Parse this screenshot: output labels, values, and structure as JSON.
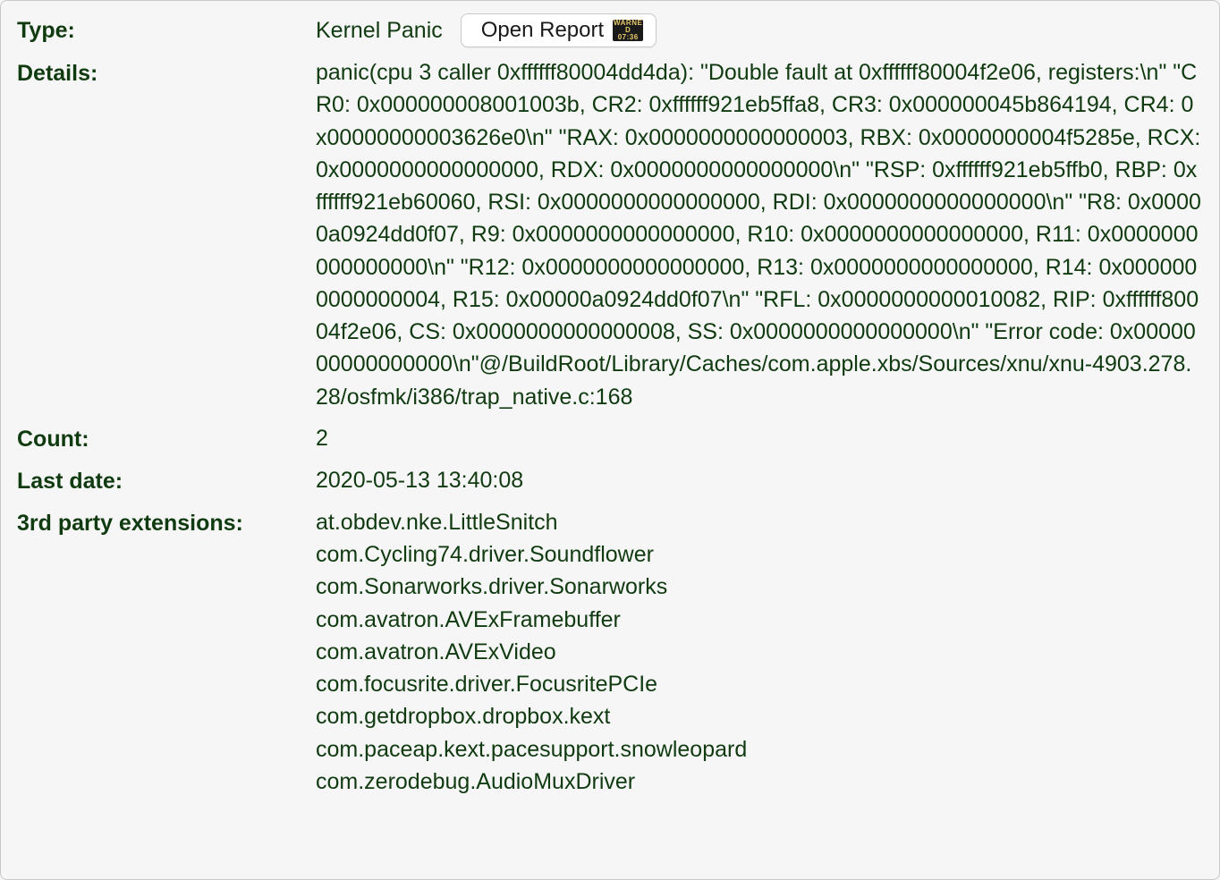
{
  "labels": {
    "type": "Type:",
    "details": "Details:",
    "count": "Count:",
    "last_date": "Last date:",
    "extensions": "3rd party extensions:"
  },
  "type_value": "Kernel Panic",
  "open_report_label": "Open Report",
  "report_icon_top": "WARNED",
  "report_icon_bottom": "07:36",
  "details_text": "panic(cpu 3 caller 0xffffff80004dd4da): \"Double fault at 0xffffff80004f2e06, registers:\\n\" \"CR0: 0x000000008001003b, CR2: 0xffffff921eb5ffa8, CR3: 0x000000045b864194, CR4: 0x00000000003626e0\\n\" \"RAX: 0x0000000000000003, RBX: 0x0000000004f5285e, RCX: 0x0000000000000000, RDX: 0x0000000000000000\\n\" \"RSP: 0xffffff921eb5ffb0, RBP: 0xffffff921eb60060, RSI: 0x0000000000000000, RDI: 0x0000000000000000\\n\" \"R8:  0x00000a0924dd0f07, R9:  0x0000000000000000, R10: 0x0000000000000000, R11: 0x0000000000000000\\n\" \"R12: 0x0000000000000000, R13: 0x0000000000000000, R14: 0x0000000000000004, R15: 0x00000a0924dd0f07\\n\" \"RFL: 0x0000000000010082, RIP: 0xffffff80004f2e06, CS:  0x0000000000000008, SS:  0x0000000000000000\\n\" \"Error code: 0x0000000000000000\\n\"@/BuildRoot/Library/Caches/com.apple.xbs/Sources/xnu/xnu-4903.278.28/osfmk/i386/trap_native.c:168",
  "count_value": "2",
  "last_date_value": "2020-05-13 13:40:08",
  "extensions": [
    "at.obdev.nke.LittleSnitch",
    "com.Cycling74.driver.Soundflower",
    "com.Sonarworks.driver.Sonarworks",
    "com.avatron.AVExFramebuffer",
    "com.avatron.AVExVideo",
    "com.focusrite.driver.FocusritePCIe",
    "com.getdropbox.dropbox.kext",
    "com.paceap.kext.pacesupport.snowleopard",
    "com.zerodebug.AudioMuxDriver"
  ]
}
